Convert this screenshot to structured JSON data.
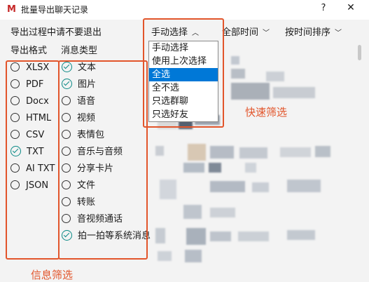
{
  "window": {
    "logo": "M",
    "title": "批量导出聊天记录",
    "help": "?",
    "close": "✕"
  },
  "labels": {
    "warning": "导出过程中请不要退出",
    "format": "导出格式",
    "msg_type": "消息类型"
  },
  "selects": {
    "mode": "手动选择",
    "time": "全部时间",
    "sort": "按时间排序"
  },
  "dropdown": {
    "options": [
      "手动选择",
      "使用上次选择",
      "全选",
      "全不选",
      "只选群聊",
      "只选好友"
    ],
    "selected": "全选"
  },
  "formats": [
    {
      "label": "XLSX",
      "checked": false
    },
    {
      "label": "PDF",
      "checked": false
    },
    {
      "label": "Docx",
      "checked": false
    },
    {
      "label": "HTML",
      "checked": false
    },
    {
      "label": "CSV",
      "checked": false
    },
    {
      "label": "TXT",
      "checked": true
    },
    {
      "label": "AI TXT",
      "checked": false
    },
    {
      "label": "JSON",
      "checked": false
    }
  ],
  "message_types": [
    {
      "label": "文本",
      "checked": true
    },
    {
      "label": "图片",
      "checked": true
    },
    {
      "label": "语音",
      "checked": false
    },
    {
      "label": "视频",
      "checked": false
    },
    {
      "label": "表情包",
      "checked": false
    },
    {
      "label": "音乐与音频",
      "checked": false
    },
    {
      "label": "分享卡片",
      "checked": false
    },
    {
      "label": "文件",
      "checked": false
    },
    {
      "label": "转账",
      "checked": false
    },
    {
      "label": "音视频通话",
      "checked": false
    },
    {
      "label": "拍一拍等系统消息",
      "checked": true
    }
  ],
  "annotations": {
    "quick_filter": "快速筛选",
    "info_filter": "信息筛选"
  },
  "colors": {
    "annotation": "#e2552b",
    "selected": "#0078d7",
    "check": "#0a8a86",
    "logo": "#c62828"
  }
}
